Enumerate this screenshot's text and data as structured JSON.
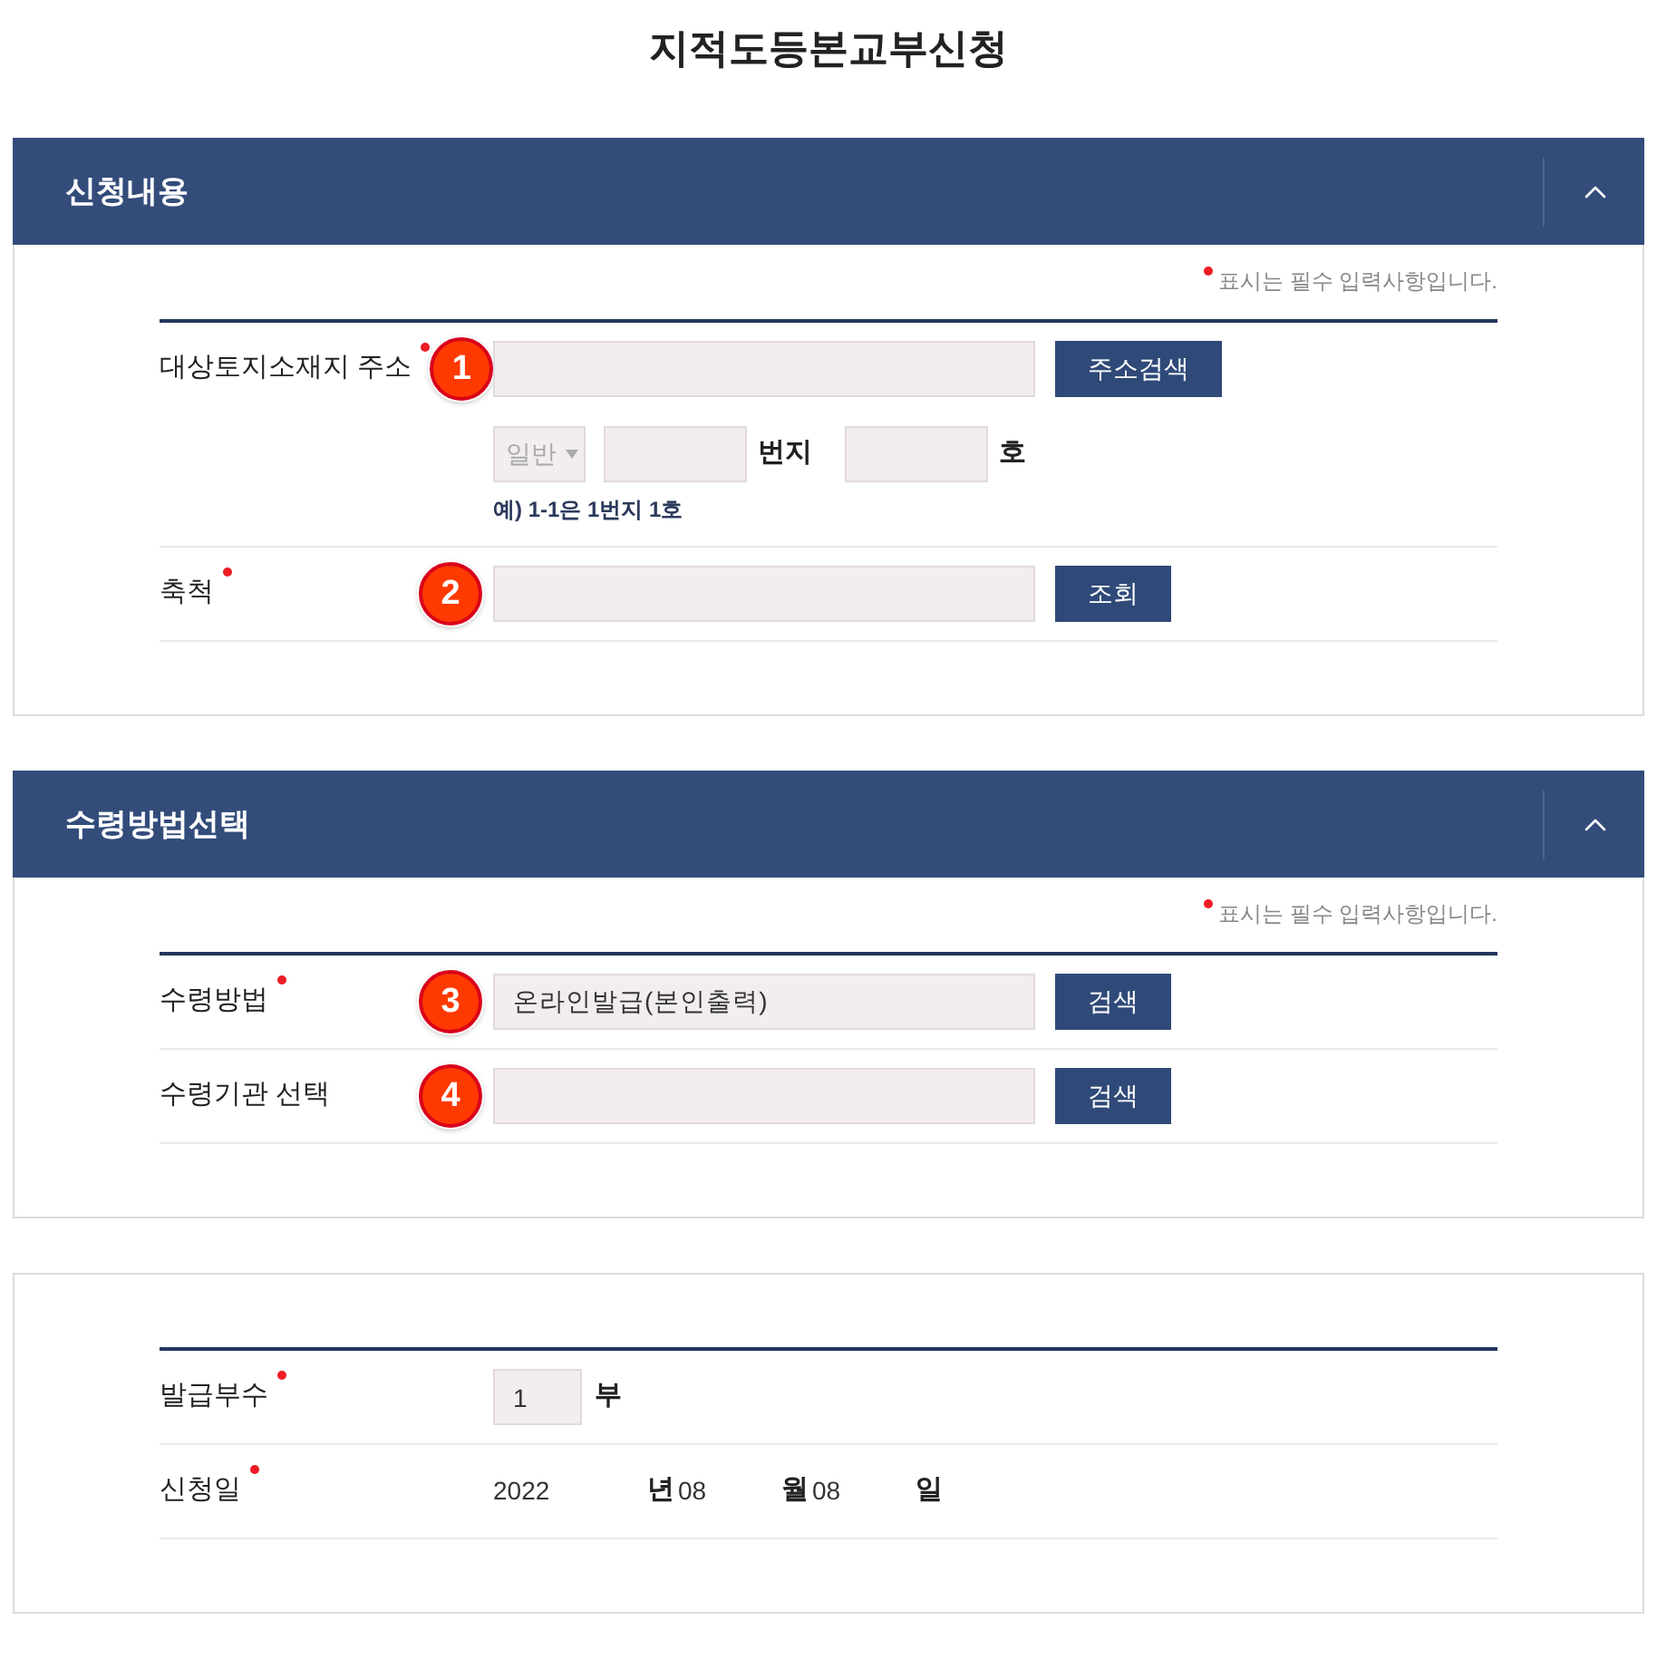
{
  "title": "지적도등본교부신청",
  "sections": [
    {
      "title": "신청내용",
      "expanded": true,
      "required_note": "표시는 필수 입력사항입니다.",
      "rows": [
        {
          "kind": "search",
          "label": "대상토지소재지 주소",
          "required": true,
          "step": "1",
          "button": "주소검색",
          "parts": [
            {
              "kind": "select",
              "value": "일반",
              "disabled": true
            },
            {
              "kind": "input"
            },
            {
              "kind": "unit",
              "text": "번지"
            },
            {
              "kind": "input"
            },
            {
              "kind": "unit",
              "text": "호"
            }
          ],
          "hint": "예) 1-1은 1번지 1호"
        },
        {
          "kind": "search",
          "label": "축척",
          "required": true,
          "step": "2",
          "button": "조회"
        }
      ]
    },
    {
      "title": "수령방법선택",
      "expanded": true,
      "required_note": "표시는 필수 입력사항입니다.",
      "rows": [
        {
          "kind": "search",
          "label": "수령방법",
          "required": true,
          "step": "3",
          "value": "온라인발급(본인출력)",
          "button": "검색"
        },
        {
          "kind": "search",
          "label": "수령기관 선택",
          "required": false,
          "step": "4",
          "button": "검색"
        }
      ]
    },
    {
      "rows": [
        {
          "kind": "count",
          "label": "발급부수",
          "required": true,
          "value": "1",
          "unit": "부"
        },
        {
          "kind": "date",
          "label": "신청일",
          "required": true,
          "parts": [
            {
              "value": "2022",
              "unit": "년"
            },
            {
              "value": "08",
              "unit": "월"
            },
            {
              "value": "08",
              "unit": "일"
            }
          ]
        }
      ]
    }
  ]
}
